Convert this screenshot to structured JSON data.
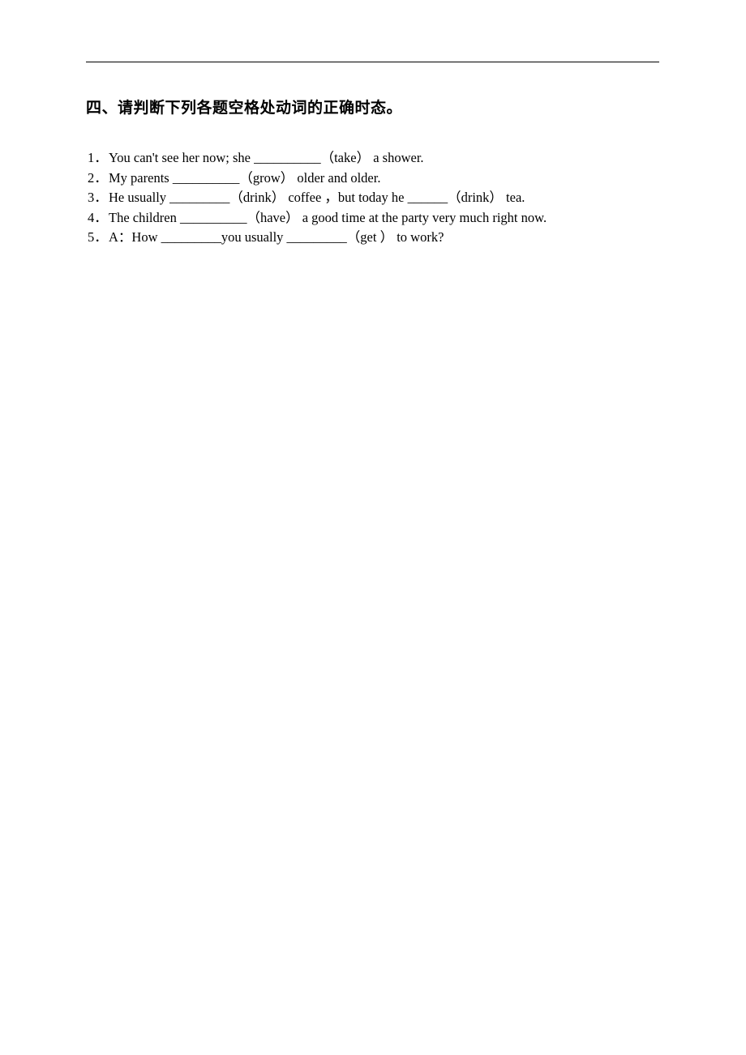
{
  "document": {
    "heading": "四、请判断下列各题空格处动词的正确时态。",
    "questions": [
      {
        "num": "1．",
        "text": "You can't see her now; she __________（take）  a shower."
      },
      {
        "num": "2．",
        "text": "My parents __________（grow）  older and older."
      },
      {
        "num": "3．",
        "text": "He usually _________（drink）  coffee ，but today he ______（drink） tea."
      },
      {
        "num": "4．",
        "text": "The children __________（have）  a good time at the party very much right now."
      },
      {
        "num": "5．",
        "text": "A：How _________you usually _________（get ）  to work?"
      }
    ]
  }
}
